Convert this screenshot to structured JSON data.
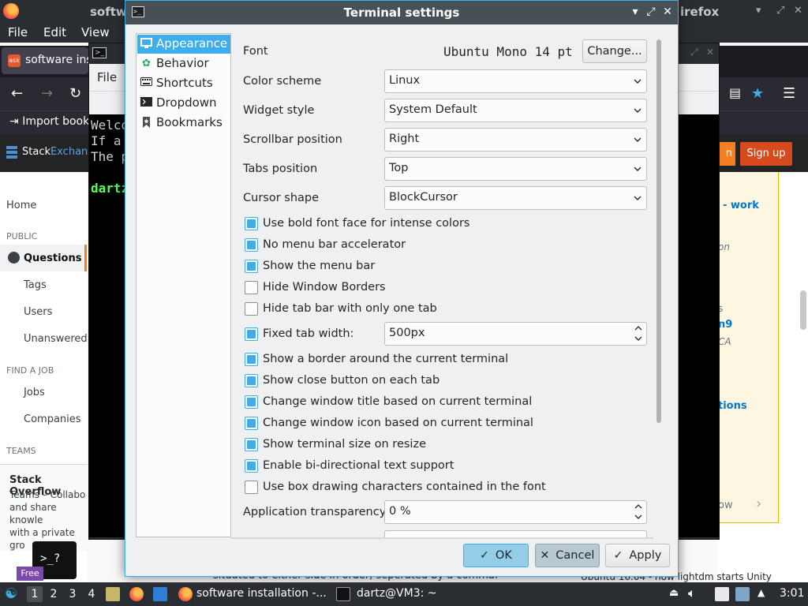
{
  "firefox": {
    "title_left": "softw",
    "title_right": "irefox",
    "menu": [
      "File",
      "Edit",
      "View"
    ],
    "tab_label": "software ins",
    "tab_favicon": "ask",
    "bookmark": "Import book",
    "se_name_a": "Stack",
    "se_name_b": "Exchange",
    "login_label": "n",
    "signup_label": "Sign up",
    "sidebar": {
      "home": "Home",
      "public": "PUBLIC",
      "questions": "Questions",
      "tags": "Tags",
      "users": "Users",
      "unanswered": "Unanswered",
      "find_a_job": "FIND A JOB",
      "jobs": "Jobs",
      "companies": "Companies",
      "teams": "TEAMS",
      "teams_title": "Stack Overflow",
      "teams_text_lines": [
        "Teams – Collabo",
        "and share knowle",
        "with a private gro"
      ]
    },
    "right_col": [
      "- work",
      "on",
      "s",
      "n9",
      "CA",
      "tions",
      "ow"
    ],
    "bottom_text": "situated to either side in order, seperated by a comma.",
    "bottom_text2": "Ubuntu 16.04 - how lightdm starts Unity"
  },
  "terminal": {
    "menu_file": "File",
    "lines": [
      "Welco",
      "If a",
      "The p"
    ],
    "prompt": "dartz"
  },
  "dialog": {
    "title": "Terminal settings",
    "categories": [
      {
        "label": "Appearance",
        "icon": "appearance-icon",
        "selected": true
      },
      {
        "label": "Behavior",
        "icon": "behavior-icon",
        "selected": false
      },
      {
        "label": "Shortcuts",
        "icon": "keyboard-icon",
        "selected": false
      },
      {
        "label": "Dropdown",
        "icon": "terminal-icon",
        "selected": false
      },
      {
        "label": "Bookmarks",
        "icon": "bookmark-icon",
        "selected": false
      }
    ],
    "font": {
      "label": "Font",
      "value": "Ubuntu Mono 14 pt",
      "button": "Change..."
    },
    "color_scheme": {
      "label": "Color scheme",
      "value": "Linux"
    },
    "widget_style": {
      "label": "Widget style",
      "value": "System Default"
    },
    "scrollbar_position": {
      "label": "Scrollbar position",
      "value": "Right"
    },
    "tabs_position": {
      "label": "Tabs position",
      "value": "Top"
    },
    "cursor_shape": {
      "label": "Cursor shape",
      "value": "BlockCursor"
    },
    "checkboxes_a": [
      {
        "label": "Use bold font face for intense colors",
        "checked": true
      },
      {
        "label": "No menu bar accelerator",
        "checked": true
      },
      {
        "label": "Show the menu bar",
        "checked": true
      },
      {
        "label": "Hide Window Borders",
        "checked": false
      },
      {
        "label": "Hide tab bar with only one tab",
        "checked": false
      }
    ],
    "fixed_tab_width": {
      "label": "Fixed tab width:",
      "checked": true,
      "value": "500px"
    },
    "checkboxes_b": [
      {
        "label": "Show a border around the current terminal",
        "checked": true
      },
      {
        "label": "Show close button on each tab",
        "checked": true
      },
      {
        "label": "Change window title based on current terminal",
        "checked": true
      },
      {
        "label": "Change window icon based on current terminal",
        "checked": true
      },
      {
        "label": "Show terminal size on resize",
        "checked": true
      },
      {
        "label": "Enable bi-directional text support",
        "checked": true
      },
      {
        "label": "Use box drawing characters contained in the font",
        "checked": false
      }
    ],
    "app_transparency": {
      "label": "Application transparency",
      "value": "0 %"
    },
    "buttons": {
      "ok": "OK",
      "cancel": "Cancel",
      "apply": "Apply"
    },
    "accent": "#3daee9"
  },
  "taskbar": {
    "workspaces": [
      "1",
      "2",
      "3",
      "4"
    ],
    "active_workspace": "1",
    "task_firefox": "software installation -...",
    "task_terminal": "dartz@VM3: ~",
    "clock": "3:01"
  },
  "float": {
    "term_glyph": ">_?",
    "free_badge": "Free"
  }
}
